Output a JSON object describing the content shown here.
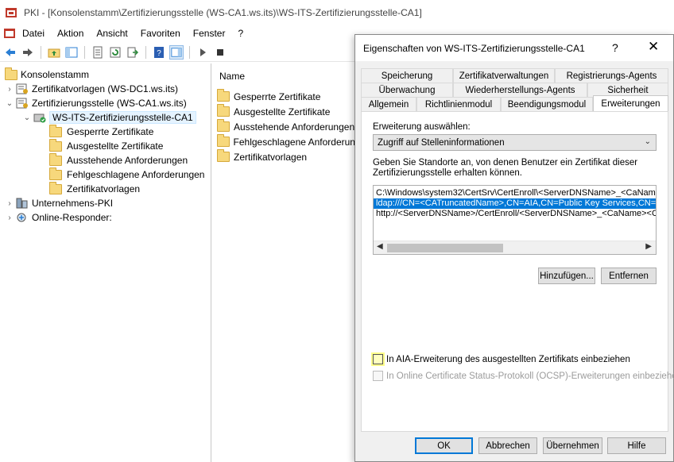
{
  "window": {
    "title": "PKI - [Konsolenstamm\\Zertifizierungsstelle (WS-CA1.ws.its)\\WS-ITS-Zertifizierungsstelle-CA1]"
  },
  "menu": [
    "Datei",
    "Aktion",
    "Ansicht",
    "Favoriten",
    "Fenster",
    "?"
  ],
  "tree": {
    "root": "Konsolenstamm",
    "templates": "Zertifikatvorlagen (WS-DC1.ws.its)",
    "ca_node": "Zertifizierungsstelle (WS-CA1.ws.its)",
    "ca_selected": "WS-ITS-Zertifizierungsstelle-CA1",
    "ca_children": [
      "Gesperrte Zertifikate",
      "Ausgestellte Zertifikate",
      "Ausstehende Anforderungen",
      "Fehlgeschlagene Anforderungen",
      "Zertifikatvorlagen"
    ],
    "enterprise_pki": "Unternehmens-PKI",
    "online_responder": "Online-Responder:"
  },
  "list": {
    "header": "Name",
    "items": [
      "Gesperrte Zertifikate",
      "Ausgestellte Zertifikate",
      "Ausstehende Anforderungen",
      "Fehlgeschlagene Anforderungen",
      "Zertifikatvorlagen"
    ]
  },
  "dialog": {
    "title": "Eigenschaften von WS-ITS-Zertifizierungsstelle-CA1",
    "help": "?",
    "close": "✕",
    "tabs_row1": [
      "Speicherung",
      "Zertifikatverwaltungen",
      "Registrierungs-Agents"
    ],
    "tabs_row2": [
      "Überwachung",
      "Wiederherstellungs-Agents",
      "Sicherheit"
    ],
    "tabs_row3": [
      "Allgemein",
      "Richtlinienmodul",
      "Beendigungsmodul",
      "Erweiterungen"
    ],
    "extension_label": "Erweiterung auswählen:",
    "extension_value": "Zugriff auf Stelleninformationen",
    "description": "Geben Sie Standorte an, von denen Benutzer ein Zertifikat dieser Zertifizierungsstelle erhalten können.",
    "urls": [
      "C:\\Windows\\system32\\CertSrv\\CertEnroll\\<ServerDNSName>_<CaName",
      "ldap:///CN=<CATruncatedName>,CN=AIA,CN=Public Key Services,CN=S",
      "http://<ServerDNSName>/CertEnroll/<ServerDNSName>_<CaName><Ce"
    ],
    "add_button": "Hinzufügen...",
    "remove_button": "Entfernen",
    "check_aia": "In AIA-Erweiterung des ausgestellten Zertifikats einbeziehen",
    "check_ocsp": "In Online Certificate Status-Protokoll (OCSP)-Erweiterungen einbeziehen",
    "ok": "OK",
    "cancel": "Abbrechen",
    "apply": "Übernehmen",
    "helpbtn": "Hilfe"
  },
  "colors": {
    "selection": "#0078d7",
    "highlight": "#ffff8a",
    "folder": "#f7d87c"
  }
}
